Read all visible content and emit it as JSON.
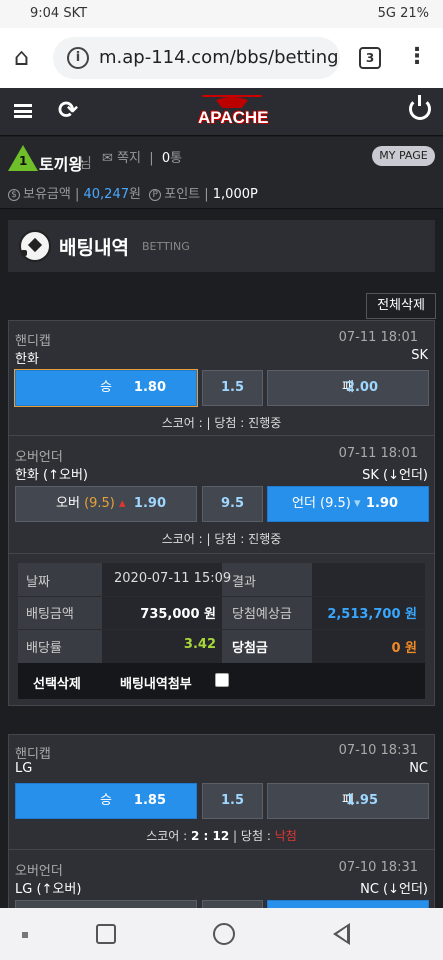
{
  "status": {
    "time": "9:04",
    "carrier": "SKT",
    "right": "5G 21%"
  },
  "browser": {
    "url": "m.ap-114.com/bbs/betting.",
    "tab_count": "3"
  },
  "header": {
    "logo": "APACHE"
  },
  "user": {
    "level": "1",
    "name": "토끼왕",
    "suffix": "님",
    "msg_label": "쪽지",
    "msg_count": "0",
    "msg_unit": "통",
    "mypage": "MY PAGE",
    "money_label": "보유금액",
    "money_value": "40,247",
    "money_unit": "원",
    "point_label": "포인트",
    "point_value": "1,000P"
  },
  "section": {
    "title": "배팅내역",
    "subtitle": "BETTING",
    "delete_all": "전체삭제"
  },
  "bet1": {
    "g1": {
      "type": "핸디캡",
      "date": "07-11  18:01",
      "home": "한화",
      "away": "SK",
      "win": "승",
      "win_odd": "1.80",
      "mid": "1.5",
      "lose": "패",
      "lose_odd": "2.00",
      "score_label": "스코어 :",
      "sep": "|",
      "result_label": "당첨 :",
      "result": "진행중"
    },
    "g2": {
      "type": "오버언더",
      "date": "07-11  18:01",
      "home": "한화 (↑오버)",
      "away": "SK (↓언더)",
      "over": "오버",
      "over_hc": "(9.5)",
      "over_odd": "1.90",
      "mid": "9.5",
      "under": "언더 (9.5)",
      "under_odd": "1.90",
      "score_label": "스코어 :",
      "sep": "|",
      "result_label": "당첨 :",
      "result": "진행중"
    },
    "summary": {
      "date_label": "날짜",
      "date_value": "2020-07-11 15:09",
      "result_label": "결과",
      "result_value": "",
      "bet_label": "배팅금액",
      "bet_value": "735,000 원",
      "expect_label": "당첨예상금",
      "expect_value": "2,513,700 원",
      "rate_label": "배당률",
      "rate_value": "3.42",
      "win_label": "당첨금",
      "win_value": "0 원",
      "delete_sel": "선택삭제",
      "attach": "배팅내역첨부"
    }
  },
  "bet2": {
    "g1": {
      "type": "핸디캡",
      "date": "07-10  18:31",
      "home": "LG",
      "away": "NC",
      "win": "승",
      "win_odd": "1.85",
      "mid": "1.5",
      "lose": "패",
      "lose_odd": "1.95",
      "score_label": "스코어 :",
      "score": "2 : 12",
      "sep": "|",
      "result_label": "당첨 :",
      "result": "낙첨"
    },
    "g2": {
      "type": "오버언더",
      "date": "07-10  18:31",
      "home": "LG (↑오버)",
      "away": "NC (↓언더)"
    }
  }
}
